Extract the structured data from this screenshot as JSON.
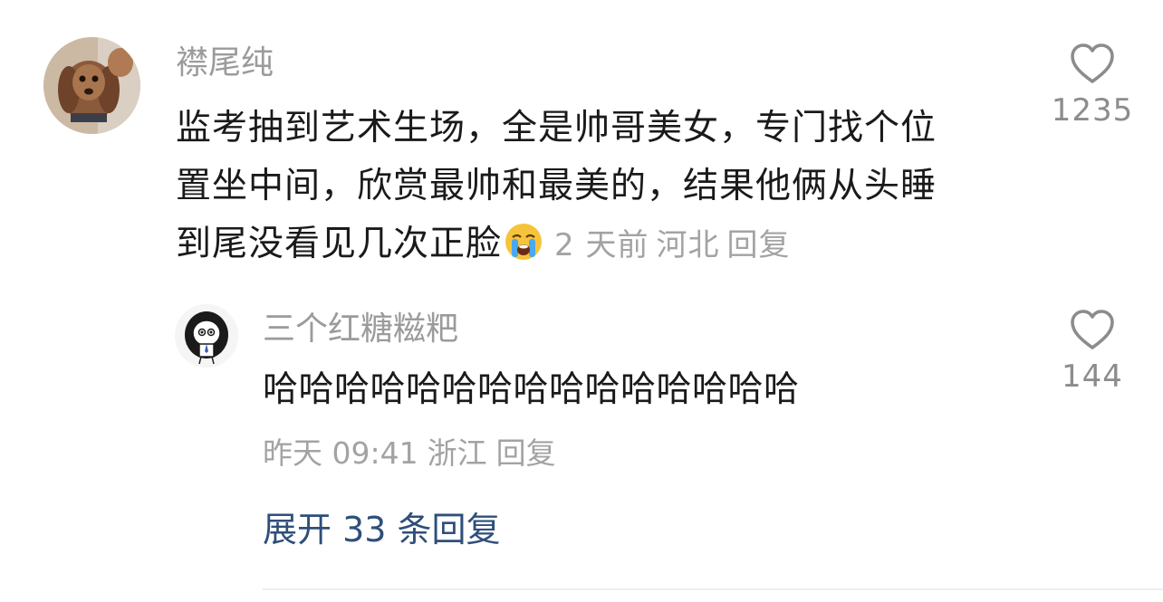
{
  "main_comment": {
    "username": "襟尾纯",
    "lines": [
      "监考抽到艺术生场，全是帅哥美女，专门找个位",
      "置坐中间，欣赏最帅和最美的，结果他俩从头睡",
      "到尾没看见几次正脸"
    ],
    "emoji": "loudly-crying-face-icon",
    "time": "2 天前",
    "location": "河北",
    "reply_label": "回复",
    "like_count": "1235"
  },
  "reply_comment": {
    "username": "三个红糖糍粑",
    "text": "哈哈哈哈哈哈哈哈哈哈哈哈哈哈哈",
    "time": "昨天 09:41",
    "location": "浙江",
    "reply_label": "回复",
    "like_count": "144"
  },
  "expand_replies": "展开 33 条回复",
  "colors": {
    "username": "#9b9b9b",
    "body": "#1a1a1a",
    "meta": "#a3a3a3",
    "link": "#2f4f7a",
    "heart": "#8c8c8c"
  }
}
